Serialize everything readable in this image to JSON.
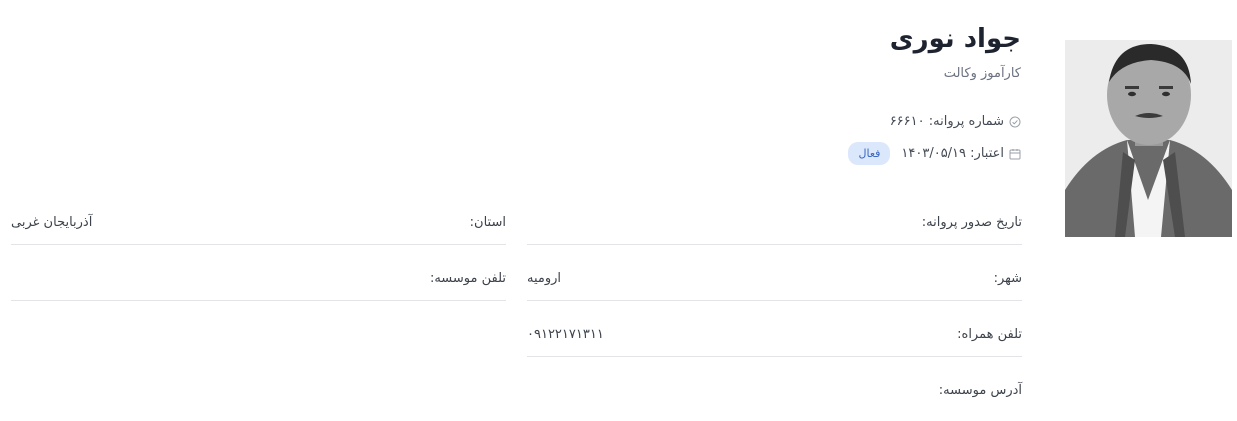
{
  "profile": {
    "name": "جواد نوری",
    "role": "کارآموز وکالت",
    "license_label": "شماره پروانه: ۶۶۶۱۰",
    "validity_label": "اعتبار: ۱۴۰۳/۰۵/۱۹",
    "status_badge": "فعال"
  },
  "fields": {
    "issue_date_label": "تاریخ صدور پروانه:",
    "issue_date_value": "",
    "province_label": "استان:",
    "province_value": "آذربایجان غربی",
    "city_label": "شهر:",
    "city_value": "ارومیه",
    "institute_phone_label": "تلفن موسسه:",
    "institute_phone_value": "",
    "mobile_label": "تلفن همراه:",
    "mobile_value": "۰۹۱۲۲۱۷۱۳۱۱",
    "institute_address_label": "آدرس موسسه:",
    "institute_address_value": ""
  },
  "icons": {
    "license": "check-circle-icon",
    "validity": "calendar-icon"
  },
  "colors": {
    "badge_bg": "#dbe7fb",
    "badge_text": "#3a66c4",
    "divider": "#e2e4e8"
  }
}
